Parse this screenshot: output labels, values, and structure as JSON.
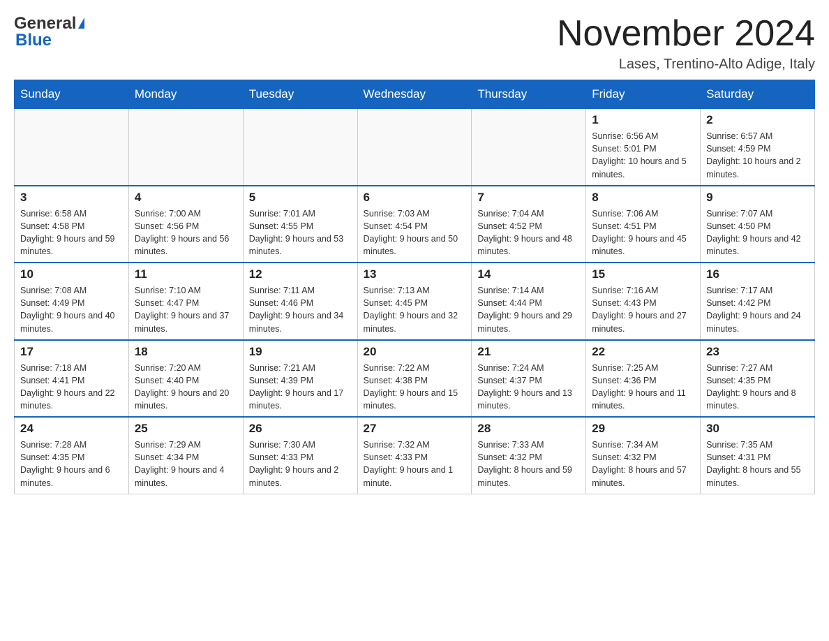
{
  "header": {
    "logo_general": "General",
    "logo_blue": "Blue",
    "month_title": "November 2024",
    "location": "Lases, Trentino-Alto Adige, Italy"
  },
  "days_of_week": [
    "Sunday",
    "Monday",
    "Tuesday",
    "Wednesday",
    "Thursday",
    "Friday",
    "Saturday"
  ],
  "weeks": [
    [
      {
        "day": "",
        "sunrise": "",
        "sunset": "",
        "daylight": ""
      },
      {
        "day": "",
        "sunrise": "",
        "sunset": "",
        "daylight": ""
      },
      {
        "day": "",
        "sunrise": "",
        "sunset": "",
        "daylight": ""
      },
      {
        "day": "",
        "sunrise": "",
        "sunset": "",
        "daylight": ""
      },
      {
        "day": "",
        "sunrise": "",
        "sunset": "",
        "daylight": ""
      },
      {
        "day": "1",
        "sunrise": "Sunrise: 6:56 AM",
        "sunset": "Sunset: 5:01 PM",
        "daylight": "Daylight: 10 hours and 5 minutes."
      },
      {
        "day": "2",
        "sunrise": "Sunrise: 6:57 AM",
        "sunset": "Sunset: 4:59 PM",
        "daylight": "Daylight: 10 hours and 2 minutes."
      }
    ],
    [
      {
        "day": "3",
        "sunrise": "Sunrise: 6:58 AM",
        "sunset": "Sunset: 4:58 PM",
        "daylight": "Daylight: 9 hours and 59 minutes."
      },
      {
        "day": "4",
        "sunrise": "Sunrise: 7:00 AM",
        "sunset": "Sunset: 4:56 PM",
        "daylight": "Daylight: 9 hours and 56 minutes."
      },
      {
        "day": "5",
        "sunrise": "Sunrise: 7:01 AM",
        "sunset": "Sunset: 4:55 PM",
        "daylight": "Daylight: 9 hours and 53 minutes."
      },
      {
        "day": "6",
        "sunrise": "Sunrise: 7:03 AM",
        "sunset": "Sunset: 4:54 PM",
        "daylight": "Daylight: 9 hours and 50 minutes."
      },
      {
        "day": "7",
        "sunrise": "Sunrise: 7:04 AM",
        "sunset": "Sunset: 4:52 PM",
        "daylight": "Daylight: 9 hours and 48 minutes."
      },
      {
        "day": "8",
        "sunrise": "Sunrise: 7:06 AM",
        "sunset": "Sunset: 4:51 PM",
        "daylight": "Daylight: 9 hours and 45 minutes."
      },
      {
        "day": "9",
        "sunrise": "Sunrise: 7:07 AM",
        "sunset": "Sunset: 4:50 PM",
        "daylight": "Daylight: 9 hours and 42 minutes."
      }
    ],
    [
      {
        "day": "10",
        "sunrise": "Sunrise: 7:08 AM",
        "sunset": "Sunset: 4:49 PM",
        "daylight": "Daylight: 9 hours and 40 minutes."
      },
      {
        "day": "11",
        "sunrise": "Sunrise: 7:10 AM",
        "sunset": "Sunset: 4:47 PM",
        "daylight": "Daylight: 9 hours and 37 minutes."
      },
      {
        "day": "12",
        "sunrise": "Sunrise: 7:11 AM",
        "sunset": "Sunset: 4:46 PM",
        "daylight": "Daylight: 9 hours and 34 minutes."
      },
      {
        "day": "13",
        "sunrise": "Sunrise: 7:13 AM",
        "sunset": "Sunset: 4:45 PM",
        "daylight": "Daylight: 9 hours and 32 minutes."
      },
      {
        "day": "14",
        "sunrise": "Sunrise: 7:14 AM",
        "sunset": "Sunset: 4:44 PM",
        "daylight": "Daylight: 9 hours and 29 minutes."
      },
      {
        "day": "15",
        "sunrise": "Sunrise: 7:16 AM",
        "sunset": "Sunset: 4:43 PM",
        "daylight": "Daylight: 9 hours and 27 minutes."
      },
      {
        "day": "16",
        "sunrise": "Sunrise: 7:17 AM",
        "sunset": "Sunset: 4:42 PM",
        "daylight": "Daylight: 9 hours and 24 minutes."
      }
    ],
    [
      {
        "day": "17",
        "sunrise": "Sunrise: 7:18 AM",
        "sunset": "Sunset: 4:41 PM",
        "daylight": "Daylight: 9 hours and 22 minutes."
      },
      {
        "day": "18",
        "sunrise": "Sunrise: 7:20 AM",
        "sunset": "Sunset: 4:40 PM",
        "daylight": "Daylight: 9 hours and 20 minutes."
      },
      {
        "day": "19",
        "sunrise": "Sunrise: 7:21 AM",
        "sunset": "Sunset: 4:39 PM",
        "daylight": "Daylight: 9 hours and 17 minutes."
      },
      {
        "day": "20",
        "sunrise": "Sunrise: 7:22 AM",
        "sunset": "Sunset: 4:38 PM",
        "daylight": "Daylight: 9 hours and 15 minutes."
      },
      {
        "day": "21",
        "sunrise": "Sunrise: 7:24 AM",
        "sunset": "Sunset: 4:37 PM",
        "daylight": "Daylight: 9 hours and 13 minutes."
      },
      {
        "day": "22",
        "sunrise": "Sunrise: 7:25 AM",
        "sunset": "Sunset: 4:36 PM",
        "daylight": "Daylight: 9 hours and 11 minutes."
      },
      {
        "day": "23",
        "sunrise": "Sunrise: 7:27 AM",
        "sunset": "Sunset: 4:35 PM",
        "daylight": "Daylight: 9 hours and 8 minutes."
      }
    ],
    [
      {
        "day": "24",
        "sunrise": "Sunrise: 7:28 AM",
        "sunset": "Sunset: 4:35 PM",
        "daylight": "Daylight: 9 hours and 6 minutes."
      },
      {
        "day": "25",
        "sunrise": "Sunrise: 7:29 AM",
        "sunset": "Sunset: 4:34 PM",
        "daylight": "Daylight: 9 hours and 4 minutes."
      },
      {
        "day": "26",
        "sunrise": "Sunrise: 7:30 AM",
        "sunset": "Sunset: 4:33 PM",
        "daylight": "Daylight: 9 hours and 2 minutes."
      },
      {
        "day": "27",
        "sunrise": "Sunrise: 7:32 AM",
        "sunset": "Sunset: 4:33 PM",
        "daylight": "Daylight: 9 hours and 1 minute."
      },
      {
        "day": "28",
        "sunrise": "Sunrise: 7:33 AM",
        "sunset": "Sunset: 4:32 PM",
        "daylight": "Daylight: 8 hours and 59 minutes."
      },
      {
        "day": "29",
        "sunrise": "Sunrise: 7:34 AM",
        "sunset": "Sunset: 4:32 PM",
        "daylight": "Daylight: 8 hours and 57 minutes."
      },
      {
        "day": "30",
        "sunrise": "Sunrise: 7:35 AM",
        "sunset": "Sunset: 4:31 PM",
        "daylight": "Daylight: 8 hours and 55 minutes."
      }
    ]
  ]
}
